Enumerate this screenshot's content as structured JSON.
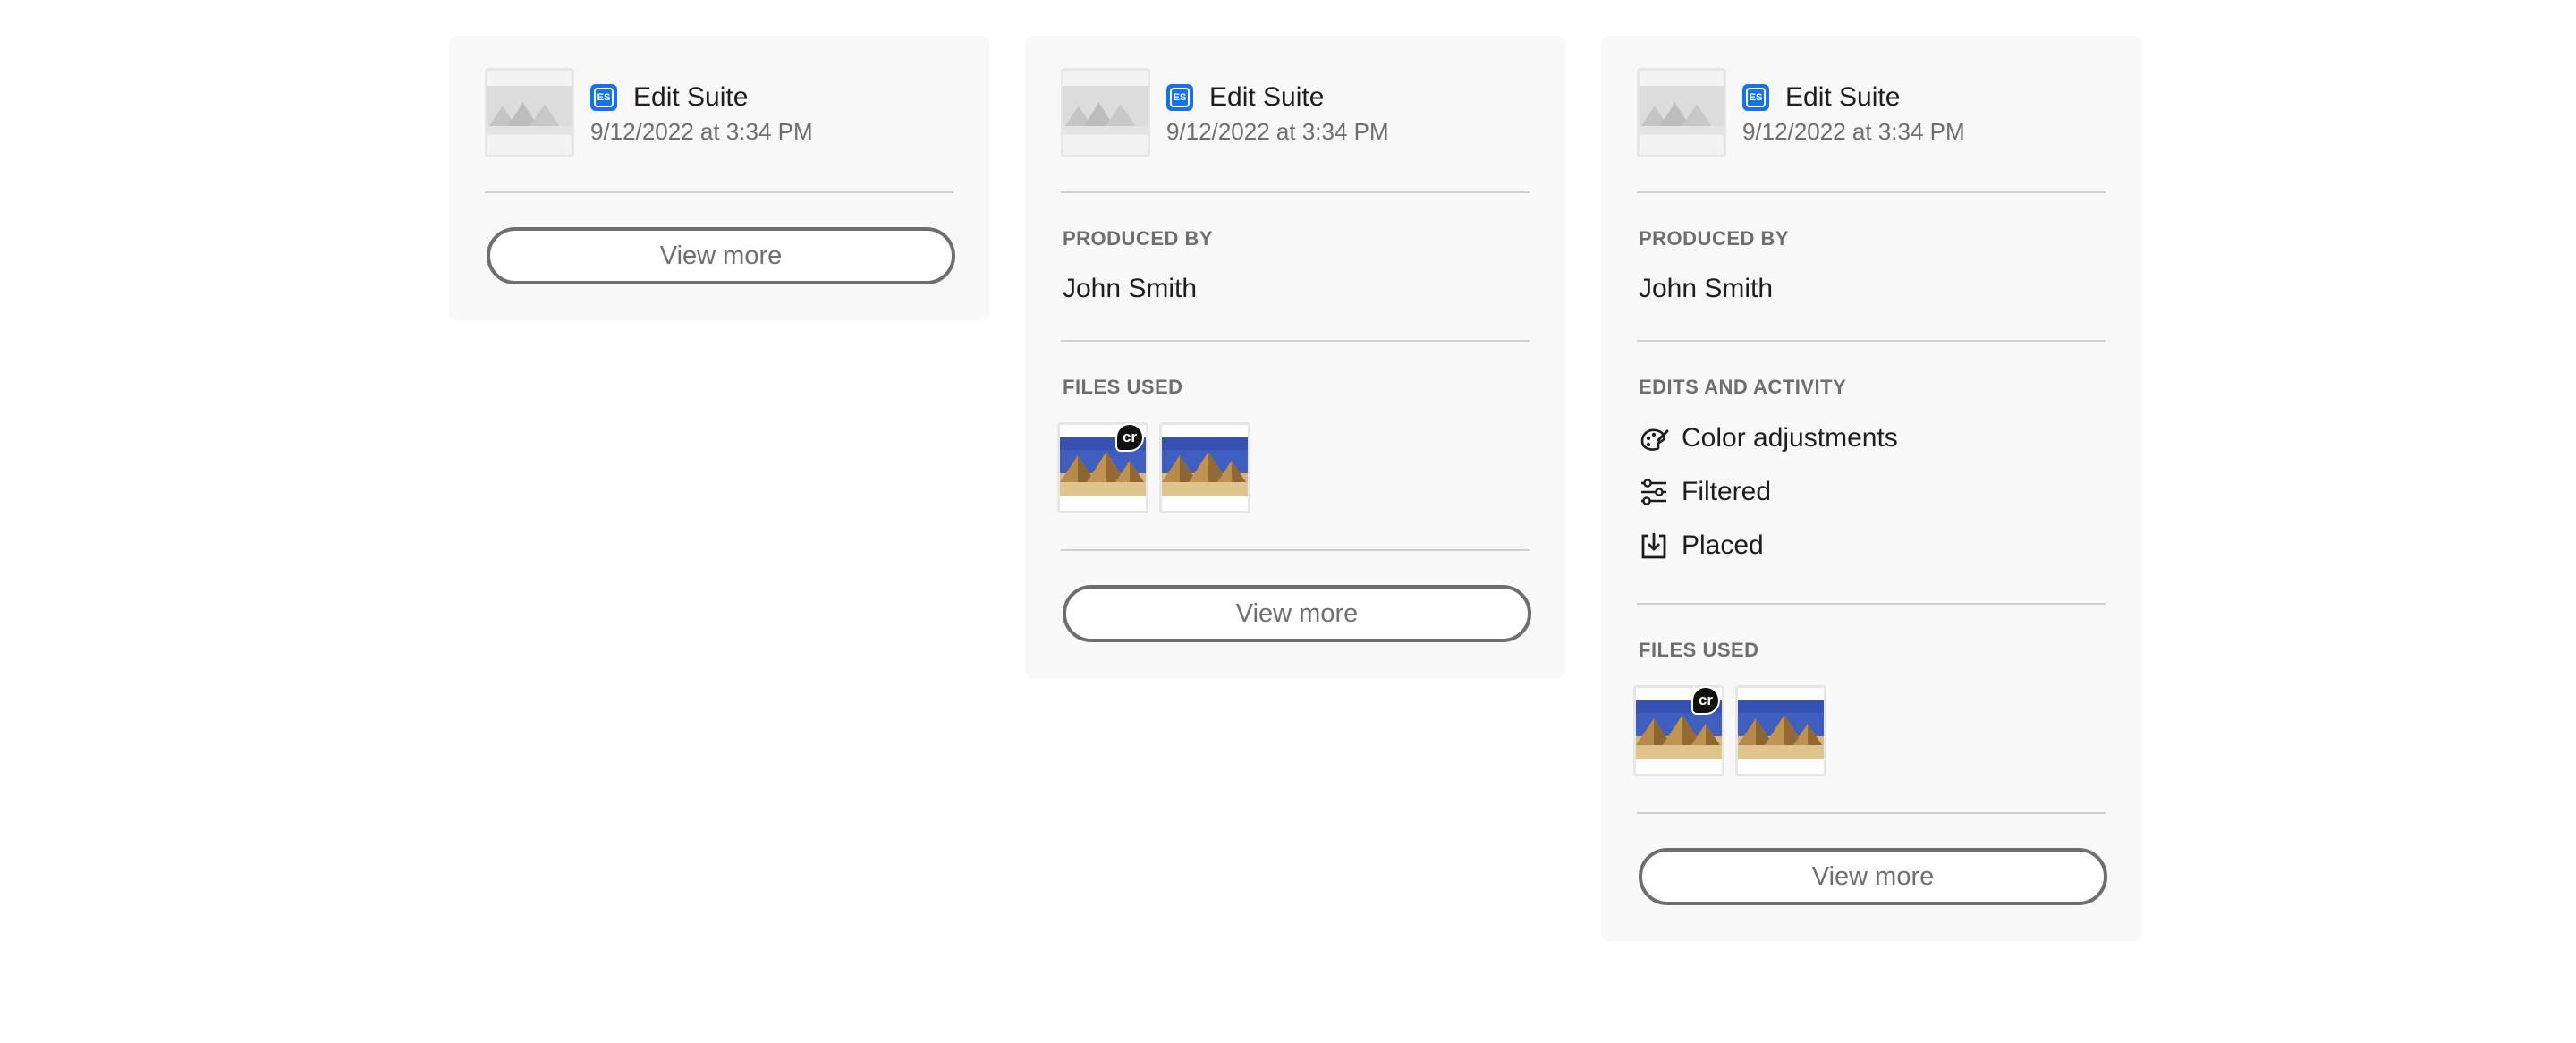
{
  "cards": [
    {
      "app_name": "Edit Suite",
      "app_badge": "ES",
      "timestamp": "9/12/2022 at 3:34 PM",
      "view_more_label": "View more"
    },
    {
      "app_name": "Edit Suite",
      "app_badge": "ES",
      "timestamp": "9/12/2022 at 3:34 PM",
      "produced_by_label": "PRODUCED BY",
      "produced_by_value": "John Smith",
      "files_used_label": "FILES USED",
      "files": [
        {
          "badge": "cr"
        },
        {
          "badge": ""
        }
      ],
      "view_more_label": "View more"
    },
    {
      "app_name": "Edit Suite",
      "app_badge": "ES",
      "timestamp": "9/12/2022 at 3:34 PM",
      "produced_by_label": "PRODUCED BY",
      "produced_by_value": "John Smith",
      "edits_label": "EDITS AND ACTIVITY",
      "edits": [
        {
          "icon": "color-palette-icon",
          "label": "Color adjustments"
        },
        {
          "icon": "sliders-icon",
          "label": "Filtered"
        },
        {
          "icon": "place-icon",
          "label": "Placed"
        }
      ],
      "files_used_label": "FILES USED",
      "files": [
        {
          "badge": "cr"
        },
        {
          "badge": ""
        }
      ],
      "view_more_label": "View more"
    }
  ],
  "colors": {
    "card_background": "#f8f8f8",
    "app_badge": "#1473e6",
    "divider": "#cfcfcf",
    "button_border": "#6e6e6e",
    "sky": "#3f5fc0",
    "sand": "#d9b77a"
  }
}
